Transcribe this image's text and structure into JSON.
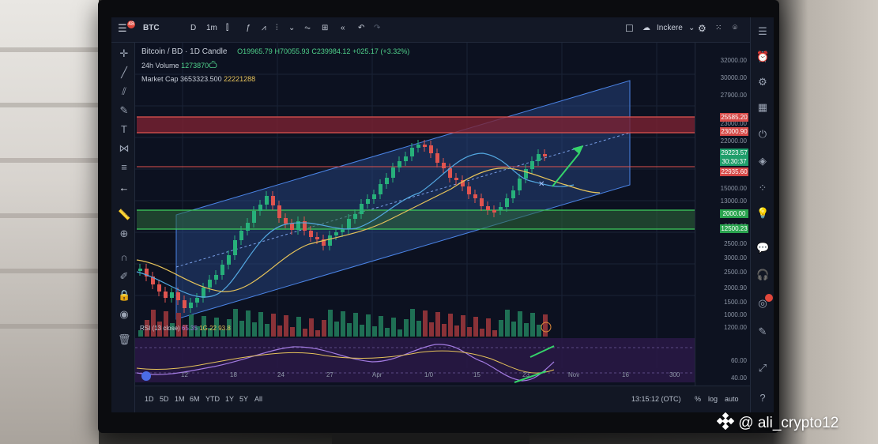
{
  "topbar": {
    "symbol": "BTC",
    "interval_d": "D",
    "interval_1m": "1m",
    "indicators_icon": "fx-icon",
    "notif_count": "48",
    "layout_name": "Inckere"
  },
  "legend": {
    "title": "Bitcoin / BD · 1D Candle",
    "ohlc_o": "O19965.79",
    "ohlc_h": "H70055.93",
    "ohlc_c": "C239984.12",
    "change": "+025.17 (+3.32%)",
    "volume_label": "24h Volume",
    "volume_value": "1273870Ѽ",
    "mcap_label": "Market Cap",
    "mcap_value": "3653323.500",
    "mcap_value2": "22221288"
  },
  "price_axis": {
    "ticks": [
      "32000.00",
      "30000.00",
      "27900.00",
      "23000.00",
      "22000.00",
      "18000.00",
      "15000.00",
      "13000.00",
      "8000.00",
      "2500.00",
      "3000.00",
      "2500.00",
      "2000.90",
      "1500.00",
      "1000.00",
      "1200.00"
    ],
    "tags": [
      {
        "text": "25585.20",
        "color": "#d64a48"
      },
      {
        "text": "23000.90",
        "color": "#d64a48"
      },
      {
        "text": "29223.57",
        "color": "#1f9e6b"
      },
      {
        "text": "30:30:37",
        "color": "#1f9e6b"
      },
      {
        "text": "22935.60",
        "color": "#d64a48"
      },
      {
        "text": "2000.00",
        "color": "#29a34e"
      },
      {
        "text": "12500.23",
        "color": "#29a34e"
      }
    ],
    "rsi_ticks": [
      "60.00",
      "40.00"
    ]
  },
  "rsi": {
    "label": "RSI (13 close)",
    "v1": "65.35",
    "v2": "1G.22",
    "v3": "93.8"
  },
  "time_axis": [
    "12",
    "18",
    "24",
    "27",
    "Apr",
    "1/0",
    "15",
    "23",
    "Nov",
    "16",
    "300"
  ],
  "bottombar": {
    "ranges": [
      "1D",
      "5D",
      "1M",
      "6M",
      "YTD",
      "1Y",
      "5Y",
      "All"
    ],
    "clock": "13:15:12 (OTC)",
    "pct": "%",
    "log": "log",
    "auto": "auto"
  },
  "watermark": "@ ali_crypto12",
  "colors": {
    "up": "#27b07a",
    "down": "#e0544f",
    "channel": "#3b6fd6",
    "resistance": "#d64a48",
    "support": "#29a34e",
    "ma_fast": "#53a7e0",
    "ma_slow": "#e6c35a",
    "rsi_line": "#a27be0"
  }
}
